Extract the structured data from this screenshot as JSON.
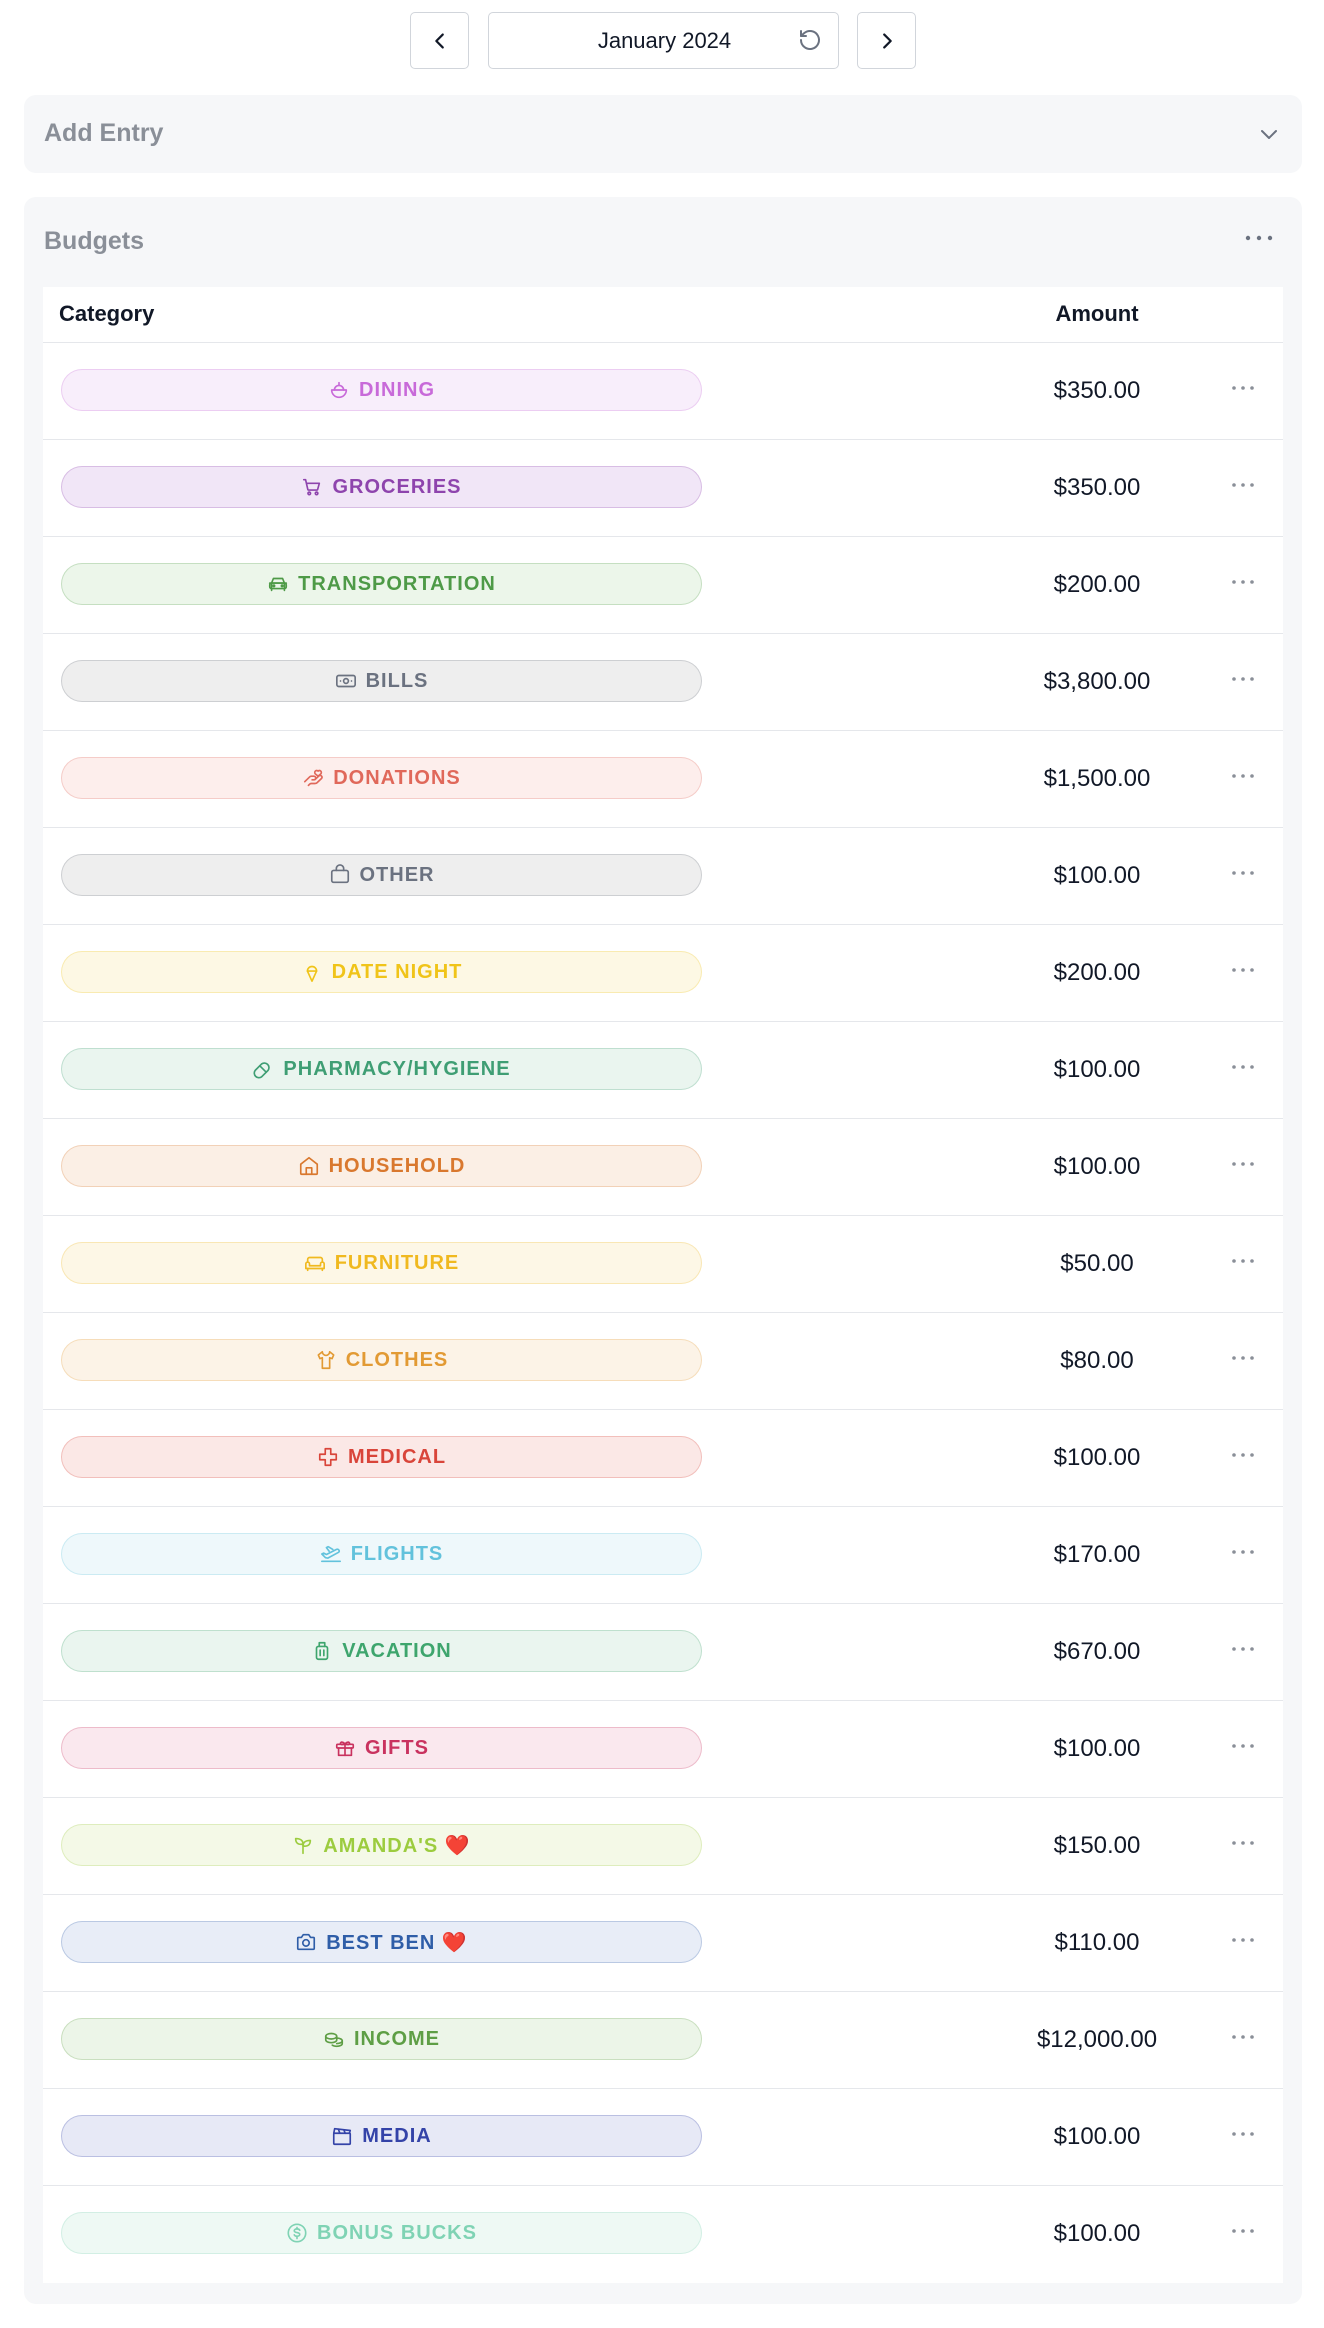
{
  "month_nav": {
    "current_month": "January 2024"
  },
  "add_entry": {
    "title": "Add Entry"
  },
  "budgets": {
    "title": "Budgets",
    "columns": {
      "category": "Category",
      "amount": "Amount"
    },
    "rows": [
      {
        "category": "DINING",
        "icon": "bowl-icon",
        "color": "#c86ad9",
        "bg": "#f8eefb",
        "amount": "$350.00"
      },
      {
        "category": "GROCERIES",
        "icon": "cart-icon",
        "color": "#8e44ad",
        "bg": "#f1e6f7",
        "amount": "$350.00"
      },
      {
        "category": "TRANSPORTATION",
        "icon": "car-icon",
        "color": "#4e9a47",
        "bg": "#ecf6ea",
        "amount": "$200.00"
      },
      {
        "category": "BILLS",
        "icon": "banknote-icon",
        "color": "#6b7280",
        "bg": "#eeeeee",
        "amount": "$3,800.00"
      },
      {
        "category": "DONATIONS",
        "icon": "hand-heart-icon",
        "color": "#e0685a",
        "bg": "#fdeeec",
        "amount": "$1,500.00"
      },
      {
        "category": "OTHER",
        "icon": "shopping-bag-icon",
        "color": "#6b7280",
        "bg": "#eeeeee",
        "amount": "$100.00"
      },
      {
        "category": "DATE NIGHT",
        "icon": "ice-cream-icon",
        "color": "#f0c419",
        "bg": "#fdf8e4",
        "amount": "$200.00"
      },
      {
        "category": "PHARMACY/HYGIENE",
        "icon": "pill-icon",
        "color": "#3f9e74",
        "bg": "#eaf5ef",
        "amount": "$100.00"
      },
      {
        "category": "HOUSEHOLD",
        "icon": "house-icon",
        "color": "#d9782e",
        "bg": "#fbefe5",
        "amount": "$100.00"
      },
      {
        "category": "FURNITURE",
        "icon": "sofa-icon",
        "color": "#f0b91f",
        "bg": "#fdf7e6",
        "amount": "$50.00"
      },
      {
        "category": "CLOTHES",
        "icon": "shirt-icon",
        "color": "#e29a34",
        "bg": "#fcf3e7",
        "amount": "$80.00"
      },
      {
        "category": "MEDICAL",
        "icon": "medical-cross-icon",
        "color": "#d9453a",
        "bg": "#fbe8e6",
        "amount": "$100.00"
      },
      {
        "category": "FLIGHTS",
        "icon": "plane-icon",
        "color": "#62c2dc",
        "bg": "#eef8fb",
        "amount": "$170.00"
      },
      {
        "category": "VACATION",
        "icon": "luggage-icon",
        "color": "#3ea56d",
        "bg": "#eaf5ef",
        "amount": "$670.00"
      },
      {
        "category": "GIFTS",
        "icon": "gift-icon",
        "color": "#c9325f",
        "bg": "#fae8ee",
        "amount": "$100.00"
      },
      {
        "category": "AMANDA'S ❤️",
        "icon": "sprout-icon",
        "color": "#9ccc3f",
        "bg": "#f4f9e7",
        "amount": "$150.00"
      },
      {
        "category": "BEST BEN ❤️",
        "icon": "camera-icon",
        "color": "#2f5ea8",
        "bg": "#e8edf7",
        "amount": "$110.00"
      },
      {
        "category": "INCOME",
        "icon": "coins-icon",
        "color": "#5e9e45",
        "bg": "#ecf5e8",
        "amount": "$12,000.00"
      },
      {
        "category": "MEDIA",
        "icon": "clapperboard-icon",
        "color": "#3443a8",
        "bg": "#e7e9f6",
        "amount": "$100.00"
      },
      {
        "category": "BONUS BUCKS",
        "icon": "dollar-circle-icon",
        "color": "#7fd3b4",
        "bg": "#eef9f4",
        "amount": "$100.00"
      }
    ]
  }
}
